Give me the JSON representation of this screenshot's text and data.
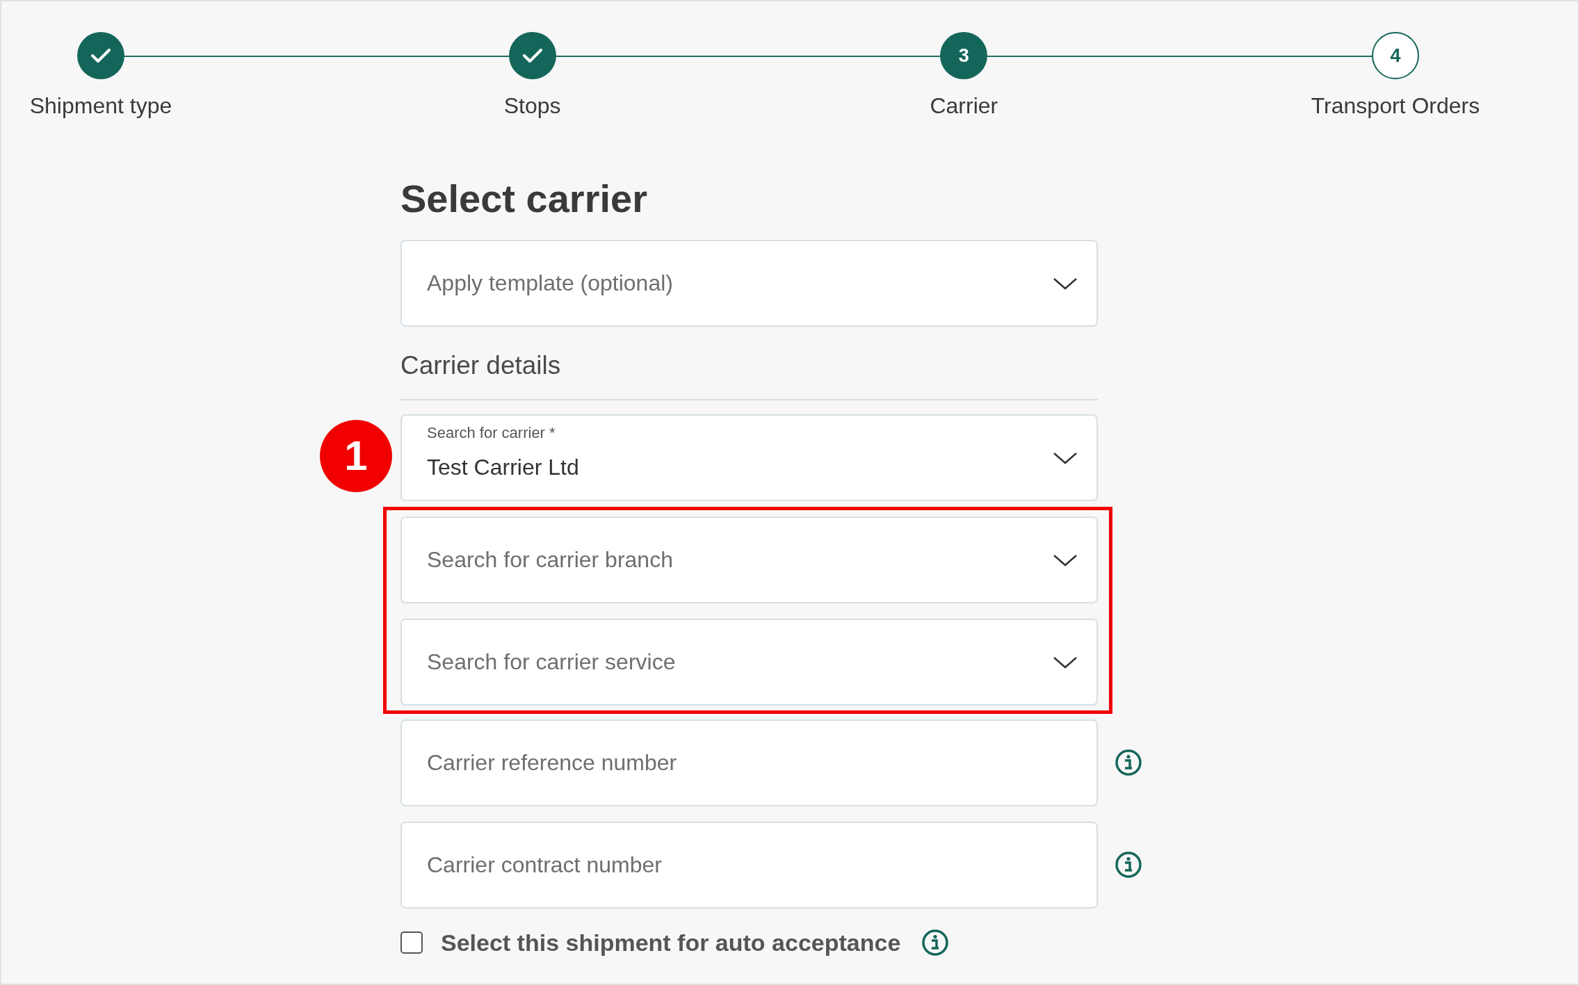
{
  "steps": [
    {
      "label": "Shipment type",
      "completed": true,
      "active": false
    },
    {
      "label": "Stops",
      "completed": true,
      "active": false
    },
    {
      "label": "Carrier",
      "number": "3",
      "completed": false,
      "active": true
    },
    {
      "label": "Transport Orders",
      "number": "4",
      "completed": false,
      "active": false
    }
  ],
  "title": "Select carrier",
  "template_select": {
    "placeholder": "Apply template (optional)"
  },
  "section": {
    "title": "Carrier details"
  },
  "annotation": {
    "number": "1"
  },
  "carrier_select": {
    "label": "Search for carrier *",
    "value": "Test Carrier Ltd"
  },
  "highlighted_selects": [
    {
      "placeholder": "Search for carrier branch"
    },
    {
      "placeholder": "Search for carrier service"
    }
  ],
  "text_fields": [
    {
      "placeholder": "Carrier reference number",
      "info": true
    },
    {
      "placeholder": "Carrier contract number",
      "info": true
    }
  ],
  "auto_acceptance": {
    "label": "Select this shipment for auto acceptance",
    "checked": false,
    "info": true
  }
}
